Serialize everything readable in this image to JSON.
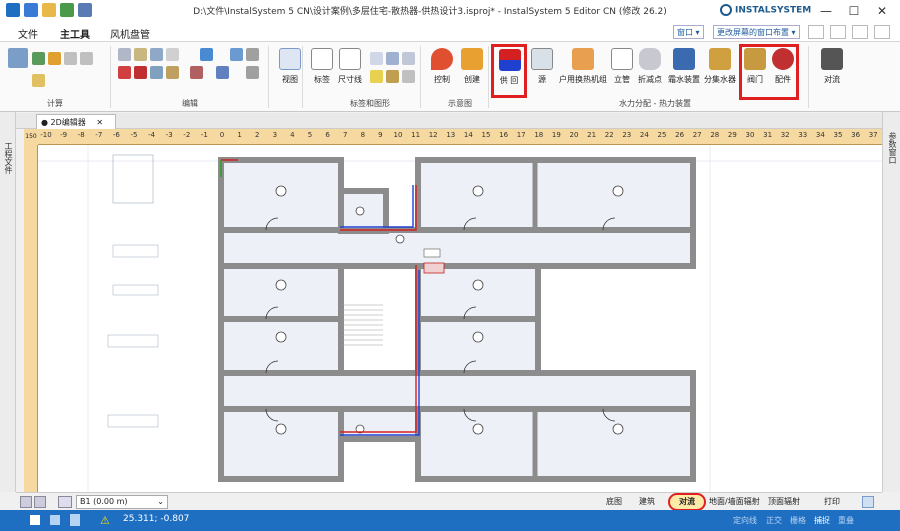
{
  "window": {
    "title": "D:\\文件\\InstalSystem 5 CN\\设计案例\\多层住宅-散热器-供热设计3.isproj* - InstalSystem 5 Editor CN (修改 26.2)",
    "brand": "INSTALSYSTEM",
    "minimize": "—",
    "maximize": "☐",
    "close": "✕"
  },
  "menu": {
    "file": "文件",
    "main_tools": "主工具",
    "fan_coil": "风机盘管",
    "window_btn": "窗口 ▾",
    "layout_btn": "更改屏幕的窗口布置 ▾"
  },
  "ribbon": {
    "groups": {
      "calc": "计算",
      "edit": "编辑",
      "labels_graphics": "标签和图形",
      "diagram": "示意图",
      "hydraulic": "水力分配 - 热力装置"
    },
    "buttons": {
      "view": "视图",
      "label": "标签",
      "dimension": "尺寸线",
      "control": "控制",
      "create": "创建",
      "supply_return": "供 回",
      "source": "源",
      "heat_exchanger": "户用换热机组",
      "riser": "立管",
      "breakpoint": "折减点",
      "compensator": "霜水装置",
      "manifold": "分集水器",
      "valve": "阀门",
      "fitting": "配件",
      "convection": "对流"
    }
  },
  "side_panels": {
    "left": "工程文件",
    "right": "参数窗口"
  },
  "document_tab": {
    "label": "● 2D编辑器",
    "close": "✕"
  },
  "ruler": {
    "corner": "150",
    "ticks": [
      "-10",
      "-9",
      "-8",
      "-7",
      "-6",
      "-5",
      "-4",
      "-3",
      "-2",
      "-1",
      "0",
      "1",
      "2",
      "3",
      "4",
      "5",
      "6",
      "7",
      "8",
      "9",
      "10",
      "11",
      "12",
      "13",
      "14",
      "15",
      "16",
      "17",
      "18",
      "19",
      "20",
      "21",
      "22",
      "23",
      "24",
      "25",
      "26",
      "27",
      "28",
      "29",
      "30",
      "31",
      "32",
      "33",
      "34",
      "35",
      "36",
      "37"
    ]
  },
  "bottom_bar": {
    "floor": "B1 (0.00 m)",
    "base_drawing": "底图",
    "building": "建筑",
    "convection": "对流",
    "floor_wall_radiant": "地面/墙面辐射",
    "ceiling_radiant": "顶面辐射",
    "print": "打印"
  },
  "status_bar": {
    "coords": "25.311; -0.807",
    "polar": "定向线",
    "ortho": "正交",
    "grid": "栅格",
    "snap": "捕捉",
    "overlap": "重叠"
  },
  "colors": {
    "accent": "#1e6fc2",
    "highlight": "#e02020",
    "ruler": "#f5d9a0",
    "wall": "#8c8c8c",
    "room": "#eef0f8",
    "pipe_supply": "#d42020",
    "pipe_return": "#2040d0"
  }
}
